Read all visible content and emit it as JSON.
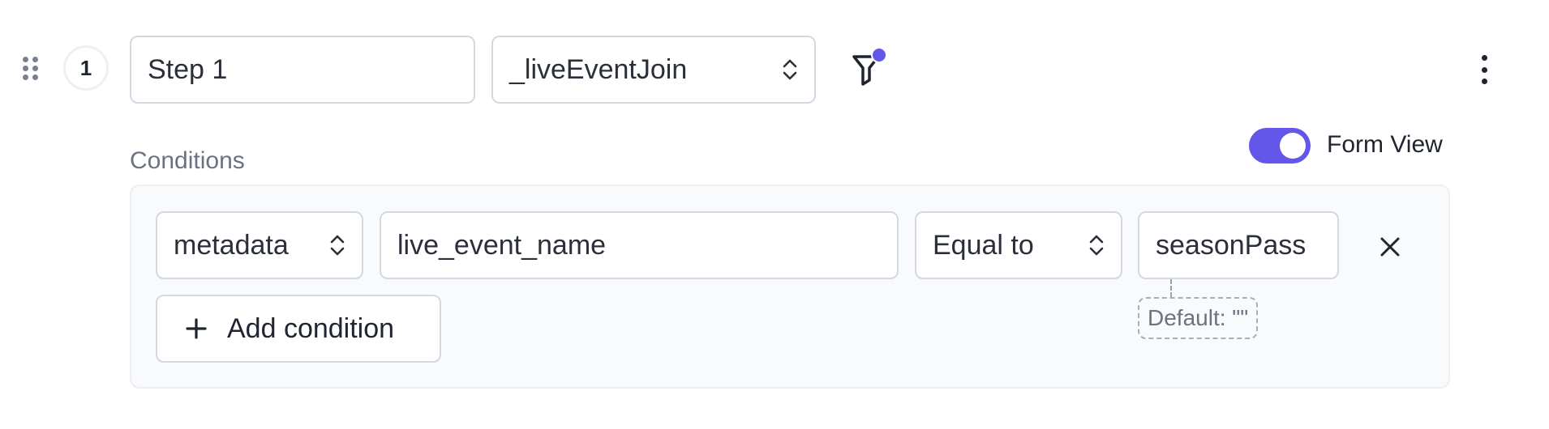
{
  "step": {
    "number": "1",
    "name_value": "Step 1",
    "event_selected": "_liveEventJoin"
  },
  "icons": {
    "drag": "drag-handle-icon",
    "filter": "filter-icon",
    "filter_indicator": "active-dot",
    "more": "more-vertical-icon",
    "chevron": "chevron-up-down-icon",
    "close": "close-icon",
    "add": "plus-icon"
  },
  "form_view": {
    "label": "Form View",
    "enabled": true
  },
  "conditions": {
    "label": "Conditions",
    "rows": [
      {
        "field": "metadata",
        "key": "live_event_name",
        "operator": "Equal to",
        "value": "seasonPass",
        "default_hint": "Default: \"\""
      }
    ],
    "add_label": "Add condition"
  },
  "colors": {
    "accent": "#6257e8",
    "border": "#d3d8e1",
    "panel_bg": "#f9fafb",
    "muted_text": "#6b7280"
  }
}
